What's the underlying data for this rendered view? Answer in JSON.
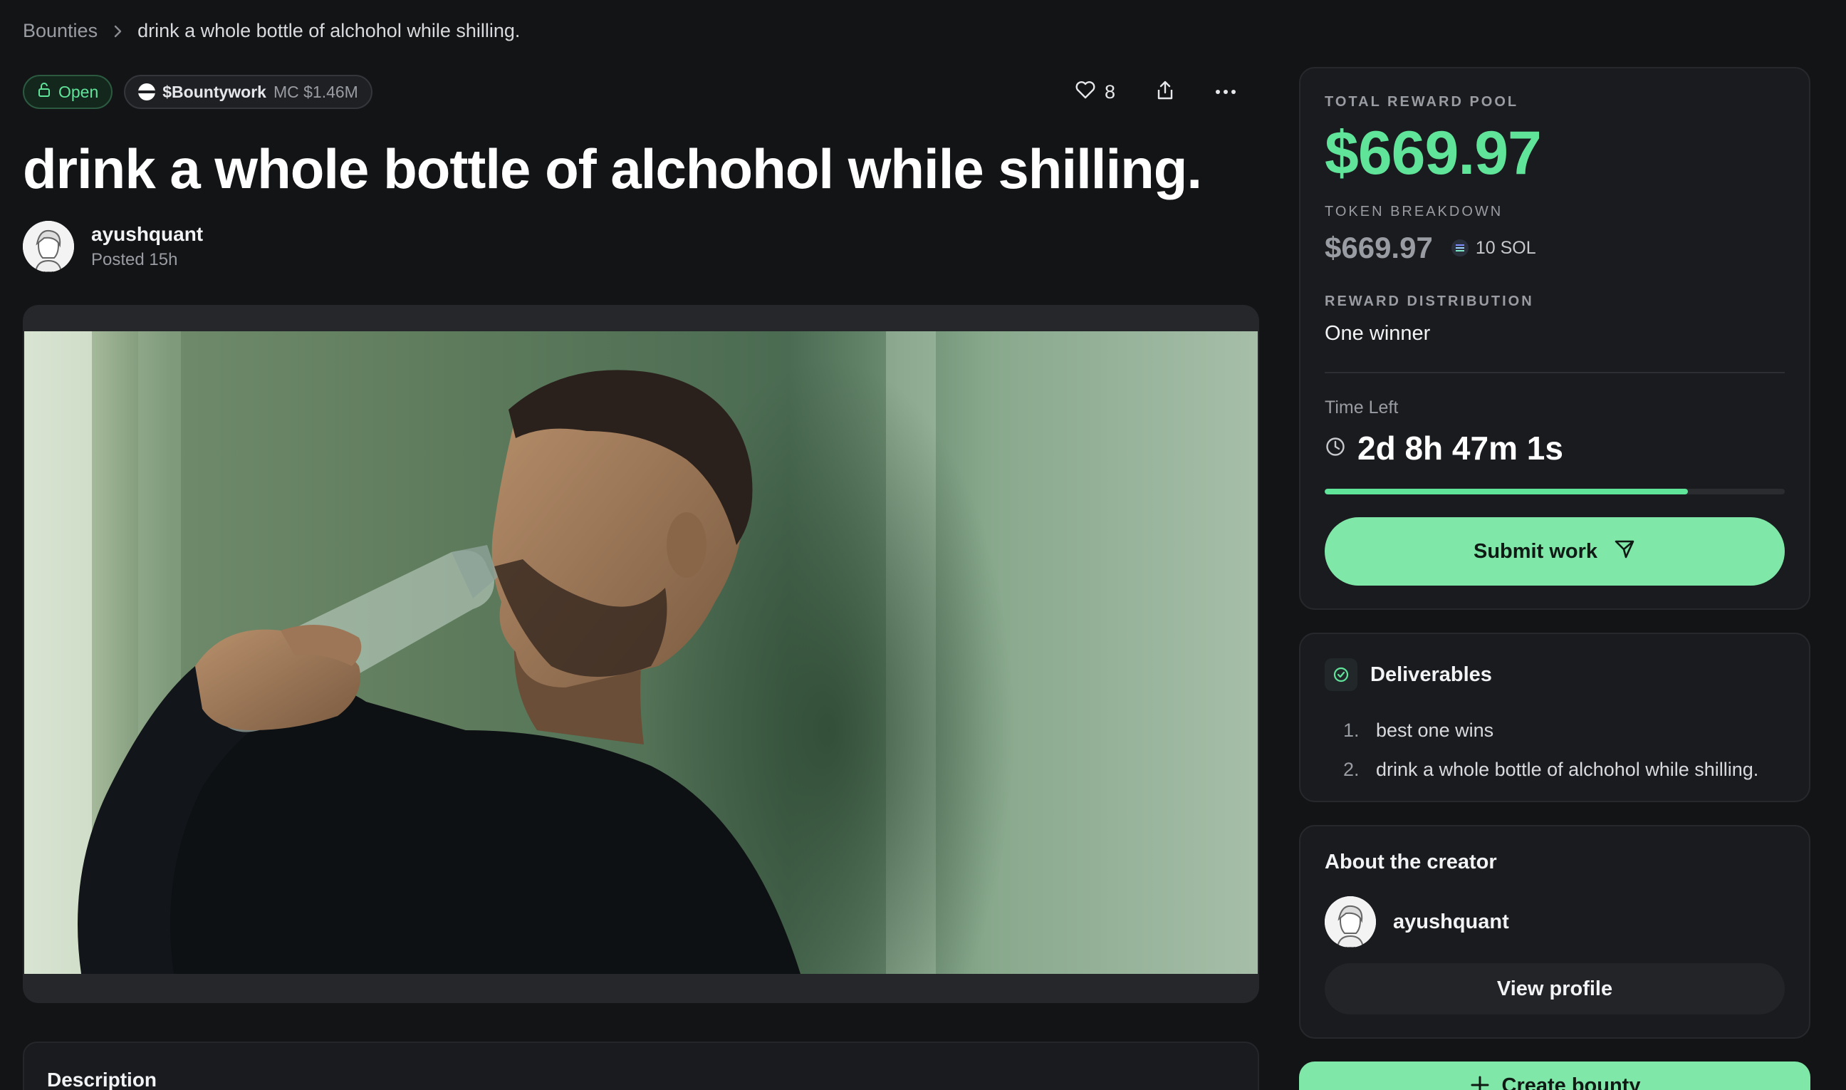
{
  "breadcrumb": {
    "root": "Bounties",
    "current": "drink a whole bottle of alchohol while shilling."
  },
  "status": {
    "label": "Open",
    "color": "#5fe49a"
  },
  "token": {
    "name": "$Bountywork",
    "market_cap": "MC $1.46M"
  },
  "actions": {
    "likes": "8",
    "icons": [
      "heart-icon",
      "share-icon",
      "more-icon"
    ]
  },
  "bounty": {
    "title": "drink a whole bottle of alchohol while shilling.",
    "author": "ayushquant",
    "posted": "Posted 15h"
  },
  "description": {
    "title": "Description"
  },
  "reward": {
    "pool_label": "TOTAL REWARD POOL",
    "pool_amount": "$669.97",
    "breakdown_label": "TOKEN BREAKDOWN",
    "breakdown_amount": "$669.97",
    "breakdown_token": "10 SOL",
    "distribution_label": "REWARD DISTRIBUTION",
    "distribution_value": "One winner",
    "time_left_label": "Time Left",
    "time_left_value": "2d 8h 47m 1s",
    "time_progress": 0.79,
    "submit_label": "Submit work",
    "accent_color": "#5fe49a"
  },
  "deliverables": {
    "title": "Deliverables",
    "items": [
      {
        "num": "1.",
        "text": "best one wins"
      },
      {
        "num": "2.",
        "text": "drink a whole bottle of alchohol while shilling."
      }
    ]
  },
  "creator": {
    "title": "About the creator",
    "name": "ayushquant",
    "view_profile_label": "View profile"
  },
  "create_bounty": {
    "label": "Create bounty"
  }
}
